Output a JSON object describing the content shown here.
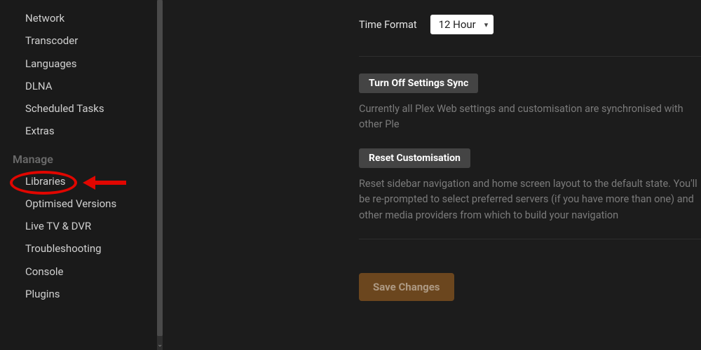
{
  "sidebar": {
    "group1": [
      {
        "label": "Network"
      },
      {
        "label": "Transcoder"
      },
      {
        "label": "Languages"
      },
      {
        "label": "DLNA"
      },
      {
        "label": "Scheduled Tasks"
      },
      {
        "label": "Extras"
      }
    ],
    "heading": "Manage",
    "group2": [
      {
        "label": "Libraries"
      },
      {
        "label": "Optimised Versions"
      },
      {
        "label": "Live TV & DVR"
      },
      {
        "label": "Troubleshooting"
      },
      {
        "label": "Console"
      },
      {
        "label": "Plugins"
      }
    ]
  },
  "main": {
    "time_format_label": "Time Format",
    "time_format_value": "12 Hour",
    "turn_off_sync_label": "Turn Off Settings Sync",
    "sync_desc": "Currently all Plex Web settings and customisation are synchronised with other Ple",
    "reset_label": "Reset Customisation",
    "reset_desc": "Reset sidebar navigation and home screen layout to the default state. You'll be re-prompted to select preferred servers (if you have more than one) and other media providers from which to build your navigation",
    "save_label": "Save Changes"
  }
}
